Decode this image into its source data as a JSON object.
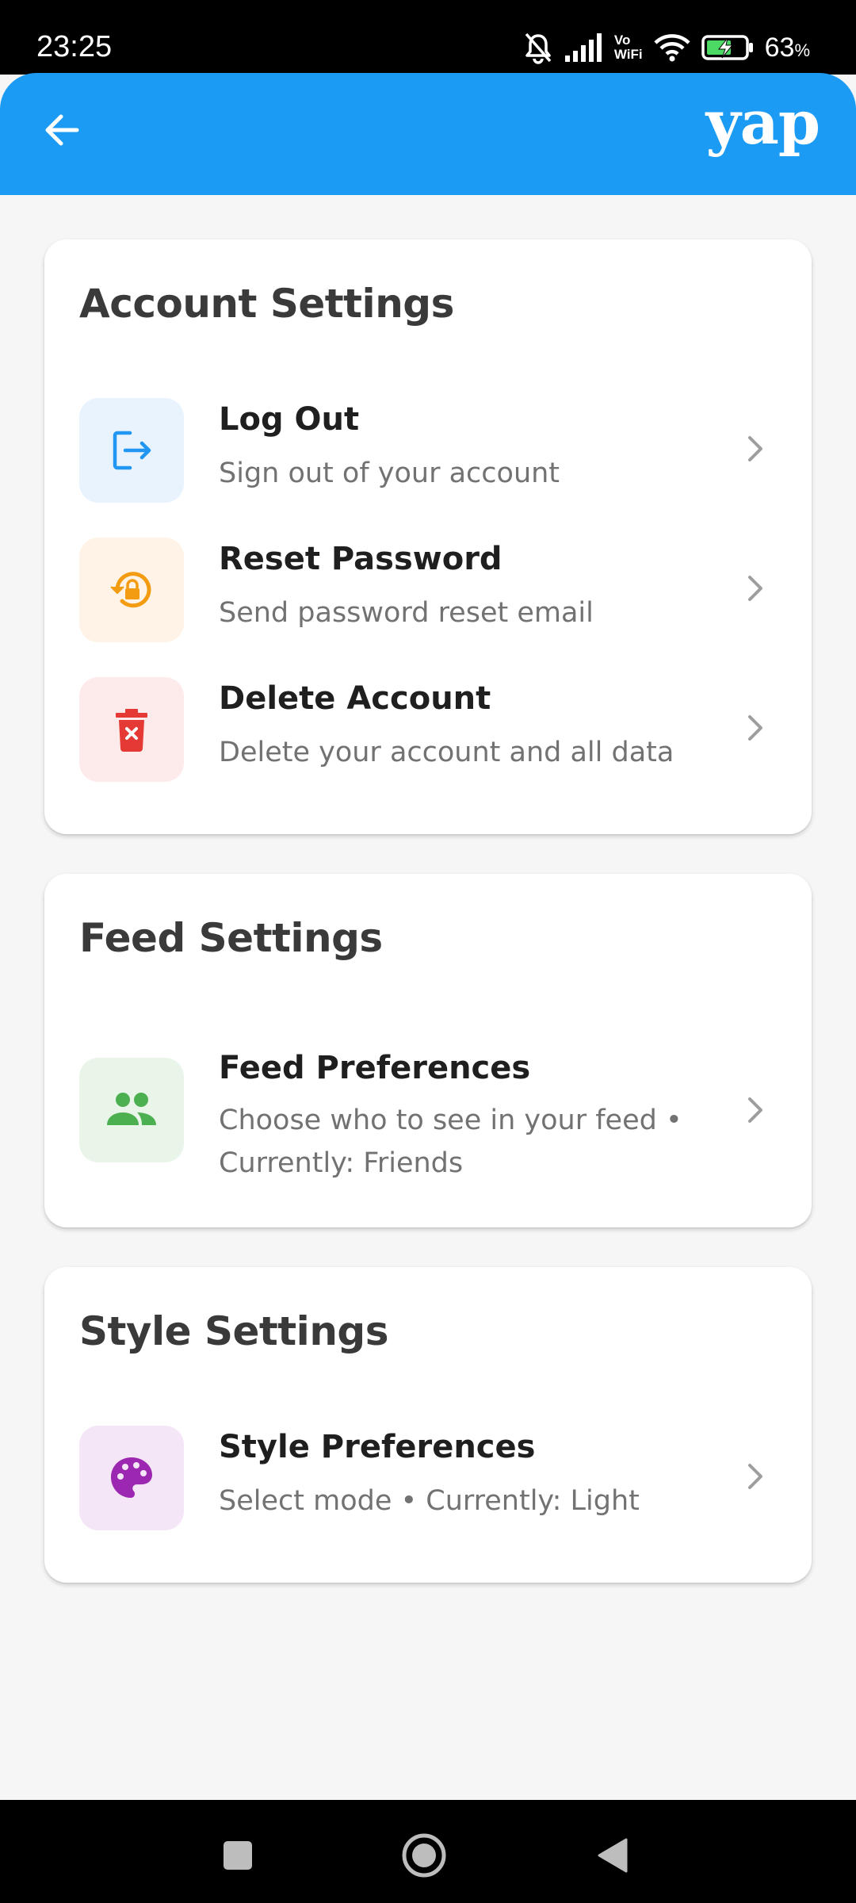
{
  "status": {
    "time": "23:25",
    "vo": "Vo",
    "wifi_label": "WiFi",
    "battery": "63",
    "battery_unit": "%"
  },
  "appbar": {
    "brand": "yap",
    "back_icon": "arrow-left-icon"
  },
  "account": {
    "title": "Account Settings",
    "items": [
      {
        "title": "Log Out",
        "subtitle": "Sign out of your account",
        "icon": "logout-icon",
        "color": "#2196f3",
        "bg": "#e8f3fe"
      },
      {
        "title": "Reset Password",
        "subtitle": "Send password reset email",
        "icon": "lock-reset-icon",
        "color": "#f39c12",
        "bg": "#fef3e6"
      },
      {
        "title": "Delete Account",
        "subtitle": "Delete your account and all data",
        "icon": "trash-icon",
        "color": "#e53935",
        "bg": "#fdeaea"
      }
    ]
  },
  "feed": {
    "title": "Feed Settings",
    "items": [
      {
        "title": "Feed Preferences",
        "subtitle": "Choose who to see in your feed • Currently: Friends",
        "icon": "people-icon",
        "color": "#4caf50",
        "bg": "#eaf5ea"
      }
    ]
  },
  "style": {
    "title": "Style Settings",
    "items": [
      {
        "title": "Style Preferences",
        "subtitle": "Select mode • Currently: Light",
        "icon": "palette-icon",
        "color": "#9c27b0",
        "bg": "#f4e6f6"
      }
    ]
  }
}
